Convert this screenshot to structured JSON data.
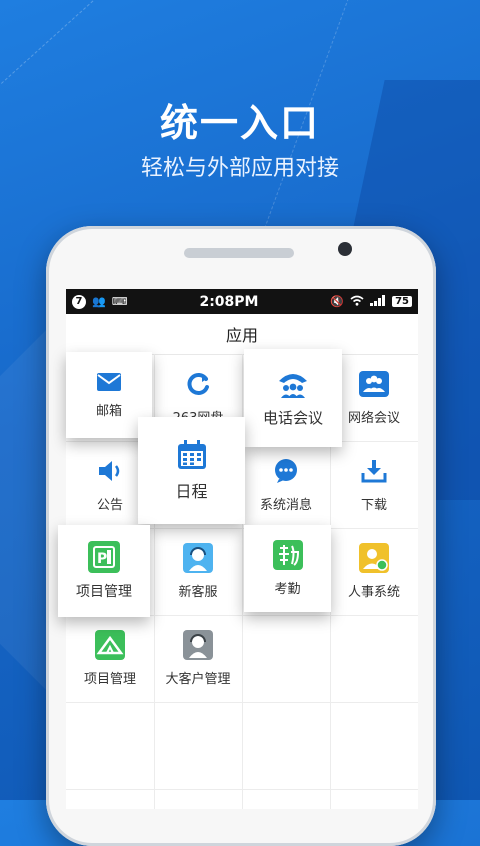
{
  "promo": {
    "headline": "统一入口",
    "subline": "轻松与外部应用对接"
  },
  "statusbar": {
    "notif_count": "7",
    "time": "2:08PM",
    "battery": "75"
  },
  "app": {
    "title": "应用"
  },
  "tiles": {
    "mail": "邮箱",
    "disk": "263网盘",
    "conference": "电话会议",
    "netmeeting": "网络会议",
    "notice": "公告",
    "calendar": "日程",
    "sysmsg": "系统消息",
    "download": "下载",
    "project1": "项目管理",
    "service": "新客服",
    "attendance": "考勤",
    "hr": "人事系统",
    "project2": "项目管理",
    "bigclient": "大客户管理"
  },
  "icons": {
    "mail": "envelope-icon",
    "disk": "sync-icon",
    "conference": "phone-conference-icon",
    "netmeeting": "group-icon",
    "notice": "speaker-icon",
    "calendar": "calendar-icon",
    "sysmsg": "chat-icon",
    "download": "download-icon",
    "project1": "project-board-icon",
    "service": "headset-agent-icon",
    "attendance": "attendance-icon",
    "hr": "person-badge-icon",
    "project2": "tent-icon",
    "bigclient": "headset-client-icon"
  },
  "colors": {
    "accent": "#1e78d6",
    "green": "#3cbf5a",
    "yellow": "#f0c12b",
    "gray": "#8a9298"
  }
}
